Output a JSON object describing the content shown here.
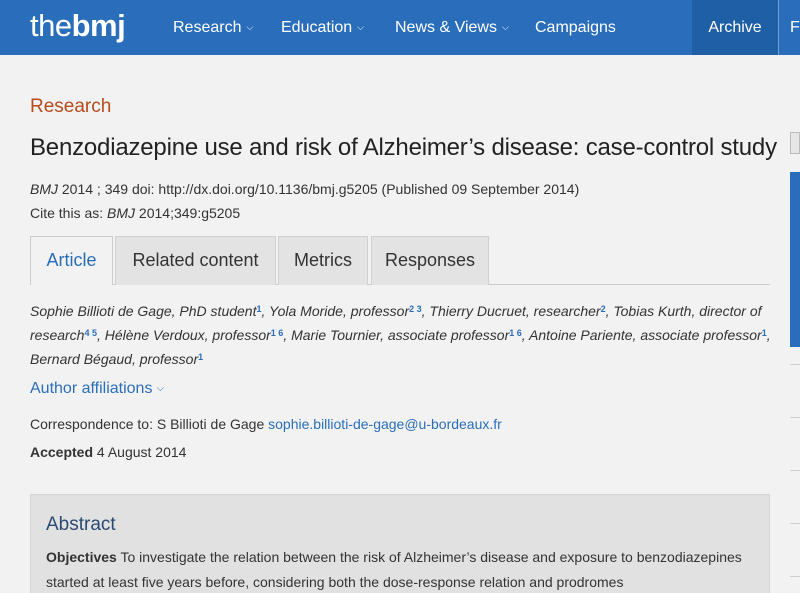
{
  "nav": {
    "logo_part1": "the",
    "logo_part2": "bmj",
    "items": [
      {
        "label": "Research"
      },
      {
        "label": "Education"
      },
      {
        "label": "News & Views"
      },
      {
        "label": "Campaigns"
      }
    ],
    "archive_label": "Archive",
    "overflow_label": "F"
  },
  "article": {
    "section": "Research",
    "title": "Benzodiazepine use and risk of Alzheimer’s disease: case-control study",
    "citation": {
      "journal": "BMJ",
      "year_vol": " 2014 ; 349  doi: ",
      "doi": "http://dx.doi.org/10.1136/bmj.g5205",
      "published": " (Published 09 September 2014)"
    },
    "cite_as": {
      "label": "Cite this as: ",
      "journal": "BMJ",
      "ref": " 2014;349:g5205"
    },
    "tabs": [
      {
        "label": "Article"
      },
      {
        "label": "Related content"
      },
      {
        "label": "Metrics"
      },
      {
        "label": "Responses"
      }
    ],
    "authors": [
      {
        "name": "Sophie Billioti de Gage, PhD student",
        "sup": "1"
      },
      {
        "name": "Yola Moride, professor",
        "sup": "2 3"
      },
      {
        "name": "Thierry Ducruet, researcher",
        "sup": "2"
      },
      {
        "name": "Tobias Kurth, director of research",
        "sup": "4 5"
      },
      {
        "name": "Hélène Verdoux, professor",
        "sup": "1 6"
      },
      {
        "name": "Marie Tournier, associate professor",
        "sup": "1 6"
      },
      {
        "name": "Antoine Pariente, associate professor",
        "sup": "1"
      },
      {
        "name": "Bernard Bégaud, professor",
        "sup": "1"
      }
    ],
    "affiliations_label": "Author affiliations",
    "correspondence": {
      "label": "Correspondence to: S Billioti de Gage ",
      "email": "sophie.billioti-de-gage@u-bordeaux.fr"
    },
    "accepted": {
      "label": "Accepted",
      "date": " 4 August 2014"
    },
    "abstract": {
      "heading": "Abstract",
      "objectives_label": "Objectives",
      "objectives_text": " To investigate the relation between the risk of Alzheimer’s disease and exposure to benzodiazepines started at least five years before, considering both the dose-response relation and prodromes"
    }
  },
  "colors": {
    "nav_blue": "#2a6ebb",
    "section_orange": "#b84a1d",
    "link_blue": "#2a6ebb"
  }
}
